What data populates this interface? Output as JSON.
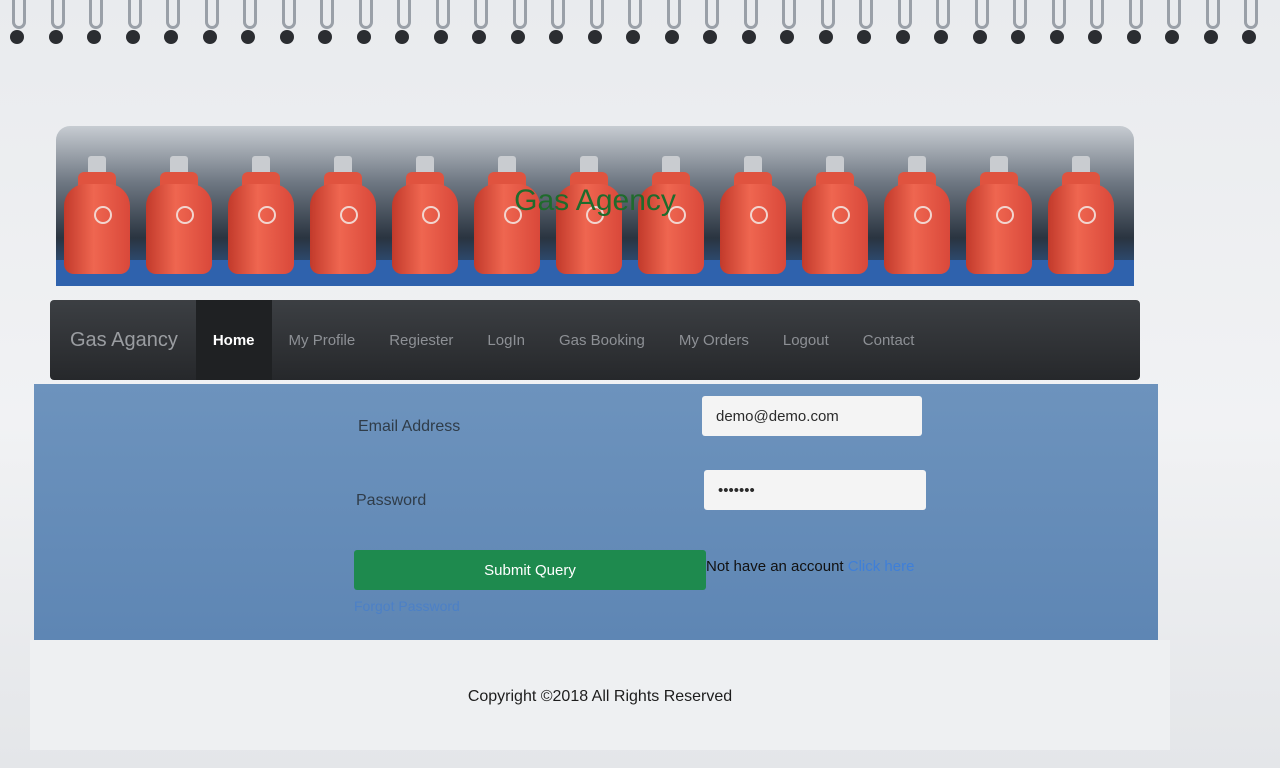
{
  "banner": {
    "title": "Gas Agency"
  },
  "navbar": {
    "brand": "Gas Agancy",
    "items": [
      {
        "label": "Home",
        "active": true
      },
      {
        "label": "My Profile"
      },
      {
        "label": "Regiester"
      },
      {
        "label": "LogIn"
      },
      {
        "label": "Gas Booking"
      },
      {
        "label": "My Orders"
      },
      {
        "label": "Logout"
      },
      {
        "label": "Contact"
      }
    ]
  },
  "login_form": {
    "email_label": "Email Address",
    "email_value": "demo@demo.com",
    "password_label": "Password",
    "password_value": "demo123",
    "submit_label": "Submit Query",
    "no_account_text": "Not have an account",
    "click_here": "Click here",
    "forgot_password": "Forgot Password"
  },
  "footer": {
    "copyright": "Copyright ©2018 All Rights Reserved"
  },
  "colors": {
    "navbar": "#2b2d30",
    "panel": "#6a90bb",
    "submit": "#1e8a4e",
    "link": "#3f7fd8"
  }
}
